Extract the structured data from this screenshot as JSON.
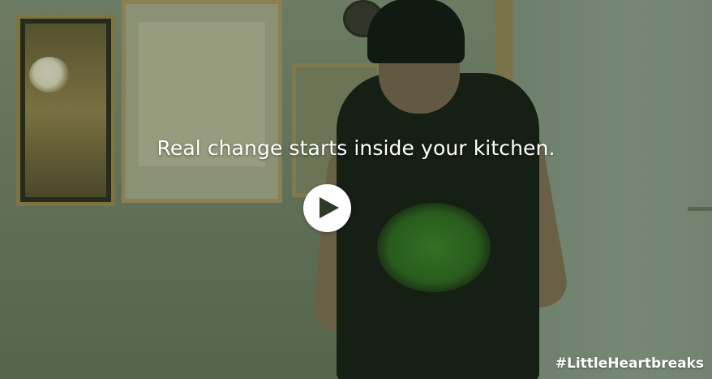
{
  "video": {
    "caption": "Real change starts inside your kitchen.",
    "hashtag": "#LittleHeartbreaks",
    "play_icon": "play-icon"
  }
}
